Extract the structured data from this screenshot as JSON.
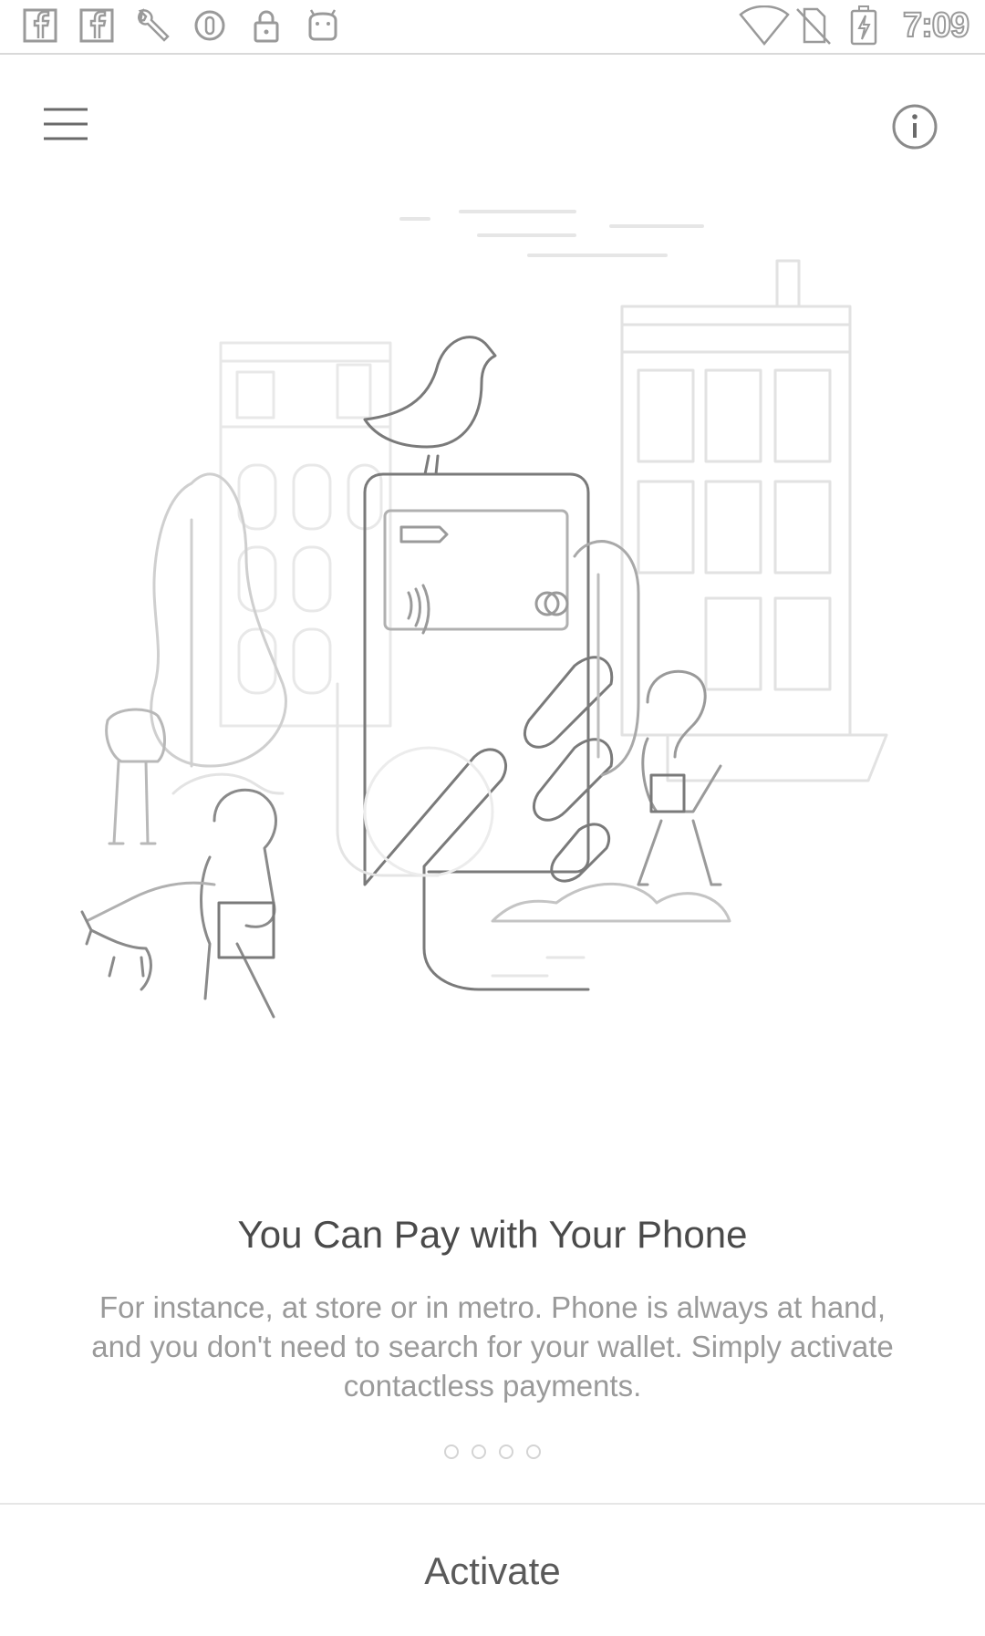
{
  "status_bar": {
    "time": "7:09",
    "left_icons": [
      "facebook-icon",
      "facebook-icon",
      "wrench-icon",
      "circle-o-icon",
      "lock-icon",
      "android-icon"
    ],
    "right_icons": [
      "wifi-icon",
      "no-sim-icon",
      "battery-charging-icon"
    ]
  },
  "toolbar": {
    "menu_icon": "hamburger-menu-icon",
    "info_icon": "info-icon"
  },
  "onboarding": {
    "title": "You Can Pay with Your Phone",
    "description": "For instance, at store or in metro. Phone is always at hand, and you don't need to search for your wallet. Simply activate contactless payments.",
    "page_count": 4
  },
  "footer": {
    "activate_label": "Activate"
  }
}
